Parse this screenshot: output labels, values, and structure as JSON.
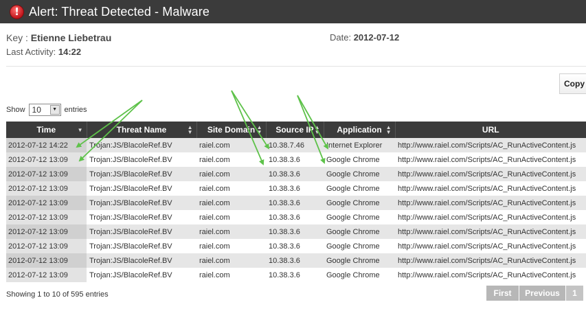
{
  "window": {
    "title": "Alert: Threat Detected - Malware",
    "icon": "alert-exclamation-icon",
    "icon_glyph": "!"
  },
  "info": {
    "key_label": "Key :",
    "key_value": "Etienne Liebetrau",
    "last_activity_label": "Last Activity:",
    "last_activity_value": "14:22",
    "date_label": "Date:",
    "date_value": "2012-07-12"
  },
  "toolbar": {
    "copy_label": "Copy"
  },
  "length_menu": {
    "show_label": "Show",
    "selected": "10",
    "entries_label": "entries"
  },
  "table": {
    "columns": [
      "Time",
      "Threat Name",
      "Site Domain",
      "Source IP",
      "Application",
      "URL"
    ],
    "rows": [
      [
        "2012-07-12 14:22",
        "Trojan:JS/BlacoleRef.BV",
        "raiel.com",
        "10.38.7.46",
        "Internet Explorer",
        "http://www.raiel.com/Scripts/AC_RunActiveContent.js"
      ],
      [
        "2012-07-12 13:09",
        "Trojan:JS/BlacoleRef.BV",
        "raiel.com",
        "10.38.3.6",
        "Google Chrome",
        "http://www.raiel.com/Scripts/AC_RunActiveContent.js"
      ],
      [
        "2012-07-12 13:09",
        "Trojan:JS/BlacoleRef.BV",
        "raiel.com",
        "10.38.3.6",
        "Google Chrome",
        "http://www.raiel.com/Scripts/AC_RunActiveContent.js"
      ],
      [
        "2012-07-12 13:09",
        "Trojan:JS/BlacoleRef.BV",
        "raiel.com",
        "10.38.3.6",
        "Google Chrome",
        "http://www.raiel.com/Scripts/AC_RunActiveContent.js"
      ],
      [
        "2012-07-12 13:09",
        "Trojan:JS/BlacoleRef.BV",
        "raiel.com",
        "10.38.3.6",
        "Google Chrome",
        "http://www.raiel.com/Scripts/AC_RunActiveContent.js"
      ],
      [
        "2012-07-12 13:09",
        "Trojan:JS/BlacoleRef.BV",
        "raiel.com",
        "10.38.3.6",
        "Google Chrome",
        "http://www.raiel.com/Scripts/AC_RunActiveContent.js"
      ],
      [
        "2012-07-12 13:09",
        "Trojan:JS/BlacoleRef.BV",
        "raiel.com",
        "10.38.3.6",
        "Google Chrome",
        "http://www.raiel.com/Scripts/AC_RunActiveContent.js"
      ],
      [
        "2012-07-12 13:09",
        "Trojan:JS/BlacoleRef.BV",
        "raiel.com",
        "10.38.3.6",
        "Google Chrome",
        "http://www.raiel.com/Scripts/AC_RunActiveContent.js"
      ],
      [
        "2012-07-12 13:09",
        "Trojan:JS/BlacoleRef.BV",
        "raiel.com",
        "10.38.3.6",
        "Google Chrome",
        "http://www.raiel.com/Scripts/AC_RunActiveContent.js"
      ],
      [
        "2012-07-12 13:09",
        "Trojan:JS/BlacoleRef.BV",
        "raiel.com",
        "10.38.3.6",
        "Google Chrome",
        "http://www.raiel.com/Scripts/AC_RunActiveContent.js"
      ]
    ]
  },
  "footer": {
    "showing": "Showing 1 to 10 of 595 entries",
    "first_label": "First",
    "previous_label": "Previous",
    "page_label": "1"
  },
  "colors": {
    "header_bg": "#3b3b3b",
    "annotation_arrow": "#5ec24a",
    "pager_bg": "#b7b7b7"
  }
}
